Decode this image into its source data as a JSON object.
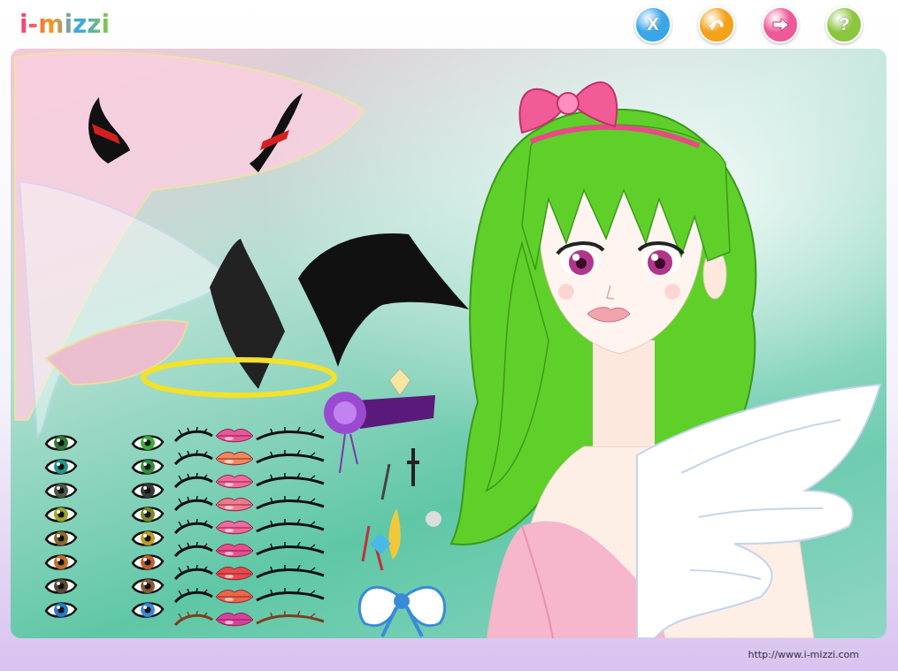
{
  "logo": {
    "text": "i-mizzi"
  },
  "toolbar": [
    {
      "kind": "close",
      "label": "X",
      "color": "#3aa6e8"
    },
    {
      "kind": "undo",
      "color": "#f3a21c"
    },
    {
      "kind": "next",
      "color": "#ee5a98"
    },
    {
      "kind": "help",
      "label": "?",
      "color": "#8cc63f"
    }
  ],
  "palette": {
    "eyes": [
      {
        "color": "#2f7a3a"
      },
      {
        "color": "#3fae3a"
      },
      {
        "color": "#1f9a8a"
      },
      {
        "color": "#2e8f3e"
      },
      {
        "color": "#4a5a4a"
      },
      {
        "color": "#3a3a3a"
      },
      {
        "color": "#9aa62a"
      },
      {
        "color": "#7a8a2a"
      },
      {
        "color": "#8a6a2a"
      },
      {
        "color": "#c09a2a"
      },
      {
        "color": "#c0702a"
      },
      {
        "color": "#c0602a"
      },
      {
        "color": "#5a4a3a"
      },
      {
        "color": "#8a5a3a"
      },
      {
        "color": "#2a7ac8"
      },
      {
        "color": "#3a8ad8"
      }
    ],
    "lips": [
      {
        "color": "#e8569c"
      },
      {
        "color": "#f08a58"
      },
      {
        "color": "#f0689e"
      },
      {
        "color": "#f07a8c"
      },
      {
        "color": "#ee6aa2"
      },
      {
        "color": "#e84e90"
      },
      {
        "color": "#e84a48"
      },
      {
        "color": "#ec6644"
      },
      {
        "color": "#d6409e"
      }
    ],
    "lashes": [
      {
        "color": "#111111"
      },
      {
        "color": "#111111"
      },
      {
        "color": "#111111"
      },
      {
        "color": "#111111"
      },
      {
        "color": "#111111"
      },
      {
        "color": "#111111"
      },
      {
        "color": "#111111"
      },
      {
        "color": "#111111"
      },
      {
        "color": "#7a4020"
      }
    ]
  },
  "footer": {
    "url": "http://www.i-mizzi.com"
  }
}
